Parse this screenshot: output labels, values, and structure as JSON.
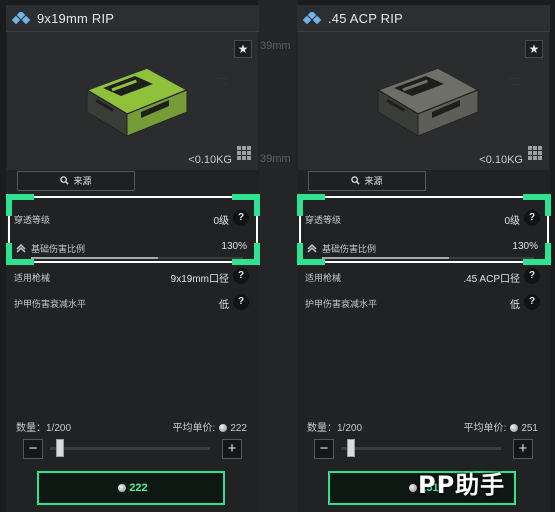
{
  "background": {
    "ghost_texts": [
      "39mm",
      "39mm"
    ]
  },
  "cards": [
    {
      "title": "9x19mm RIP",
      "weight": "<0.10KG",
      "box_color": "#8fc23a",
      "source_label": "来源",
      "stats": [
        {
          "label": "穿透等级",
          "value": "0级"
        },
        {
          "label": "基础伤害比例",
          "value": "130%",
          "bar_fraction": 0.6
        },
        {
          "label": "适用枪械",
          "value": "9x19mm口径"
        },
        {
          "label": "护甲伤害衰减水平",
          "value": "低"
        }
      ],
      "quantity_label": "数量：1/200",
      "avg_price_label": "平均单价:",
      "avg_price": "222",
      "buy_total": "222",
      "slider_fraction": 0.0
    },
    {
      "title": ".45 ACP RIP",
      "weight": "<0.10KG",
      "box_color": "#6e6f66",
      "source_label": "来源",
      "stats": [
        {
          "label": "穿透等级",
          "value": "0级"
        },
        {
          "label": "基础伤害比例",
          "value": "130%",
          "bar_fraction": 0.6
        },
        {
          "label": "适用枪械",
          "value": ".45 ACP口径"
        },
        {
          "label": "护甲伤害衰减水平",
          "value": "低"
        }
      ],
      "quantity_label": "数量：1/200",
      "avg_price_label": "平均单价:",
      "avg_price": "251",
      "buy_total": "251",
      "slider_fraction": 0.0
    }
  ],
  "watermark": "PP助手",
  "colors": {
    "accent": "#2ee28f",
    "panel": "#202223",
    "title_icon": "#6fb5e8"
  },
  "icons": [
    "diamond-icon",
    "star-icon",
    "grid-icon",
    "search-icon",
    "help-icon",
    "arrow-icon",
    "coin-icon"
  ]
}
